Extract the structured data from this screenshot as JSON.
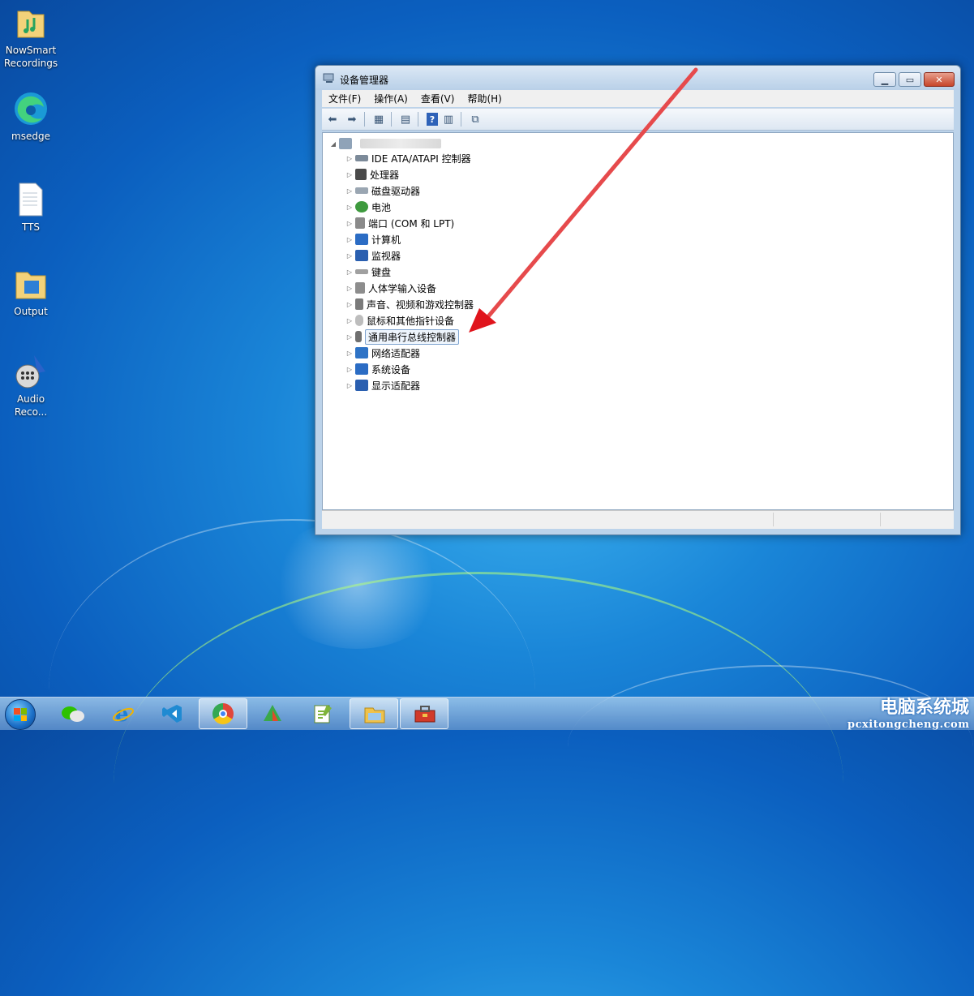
{
  "desktop": {
    "icons": [
      {
        "label": "NowSmart\nRecordings",
        "icon": "folder-audio-icon"
      },
      {
        "label": "msedge",
        "icon": "edge-icon"
      },
      {
        "label": "TTS",
        "icon": "text-file-icon"
      },
      {
        "label": "Output",
        "icon": "folder-icon"
      },
      {
        "label": "Audio\nReco...",
        "icon": "microphone-icon"
      }
    ]
  },
  "window": {
    "title": "设备管理器",
    "menu": [
      "文件(F)",
      "操作(A)",
      "查看(V)",
      "帮助(H)"
    ],
    "toolbar": [
      "back-icon",
      "forward-icon",
      "properties-icon",
      "view-icon",
      "help-icon",
      "view-hidden-icon",
      "scan-hardware-icon"
    ],
    "tree": {
      "root_label": "",
      "items": [
        {
          "label": "IDE ATA/ATAPI 控制器",
          "icon": "ide-controller-icon",
          "color": "#7c8a99"
        },
        {
          "label": "处理器",
          "icon": "processor-icon",
          "color": "#4a4a4a"
        },
        {
          "label": "磁盘驱动器",
          "icon": "disk-drive-icon",
          "color": "#9aa6b2"
        },
        {
          "label": "电池",
          "icon": "battery-icon",
          "color": "#3e9a3e"
        },
        {
          "label": "端口 (COM 和 LPT)",
          "icon": "port-icon",
          "color": "#8a8a8a"
        },
        {
          "label": "计算机",
          "icon": "computer-icon",
          "color": "#2b6cc4"
        },
        {
          "label": "监视器",
          "icon": "monitor-icon",
          "color": "#2a5fb0"
        },
        {
          "label": "键盘",
          "icon": "keyboard-icon",
          "color": "#a0a0a0"
        },
        {
          "label": "人体学输入设备",
          "icon": "hid-icon",
          "color": "#8d8d8d"
        },
        {
          "label": "声音、视频和游戏控制器",
          "icon": "speaker-icon",
          "color": "#7a7a7a"
        },
        {
          "label": "鼠标和其他指针设备",
          "icon": "mouse-icon",
          "color": "#bdbdbd"
        },
        {
          "label": "通用串行总线控制器",
          "icon": "usb-icon",
          "color": "#6f6f6f",
          "selected": true
        },
        {
          "label": "网络适配器",
          "icon": "network-adapter-icon",
          "color": "#2e73c6"
        },
        {
          "label": "系统设备",
          "icon": "system-device-icon",
          "color": "#2b6cc4"
        },
        {
          "label": "显示适配器",
          "icon": "display-adapter-icon",
          "color": "#2a5fb0"
        }
      ]
    }
  },
  "taskbar": {
    "start": "start-button",
    "apps": [
      {
        "icon": "wechat-icon",
        "color": "#2dc100",
        "active": false
      },
      {
        "icon": "internet-explorer-icon",
        "color": "#1e7fd6",
        "active": false
      },
      {
        "icon": "vscode-icon",
        "color": "#1f8ad2",
        "active": false
      },
      {
        "icon": "chrome-icon",
        "color": "#e0463a",
        "active": true
      },
      {
        "icon": "app-icon",
        "color": "#3aa84a",
        "active": false
      },
      {
        "icon": "notepad-plus-icon",
        "color": "#7fb43a",
        "active": false
      },
      {
        "icon": "file-explorer-icon",
        "color": "#f0c24a",
        "active": true
      },
      {
        "icon": "toolbox-icon",
        "color": "#d13a2a",
        "active": true
      }
    ]
  },
  "watermark": {
    "title": "电脑系统城",
    "url": "pcxitongcheng.com"
  },
  "annotation": {
    "arrow_color": "#e0141c"
  }
}
